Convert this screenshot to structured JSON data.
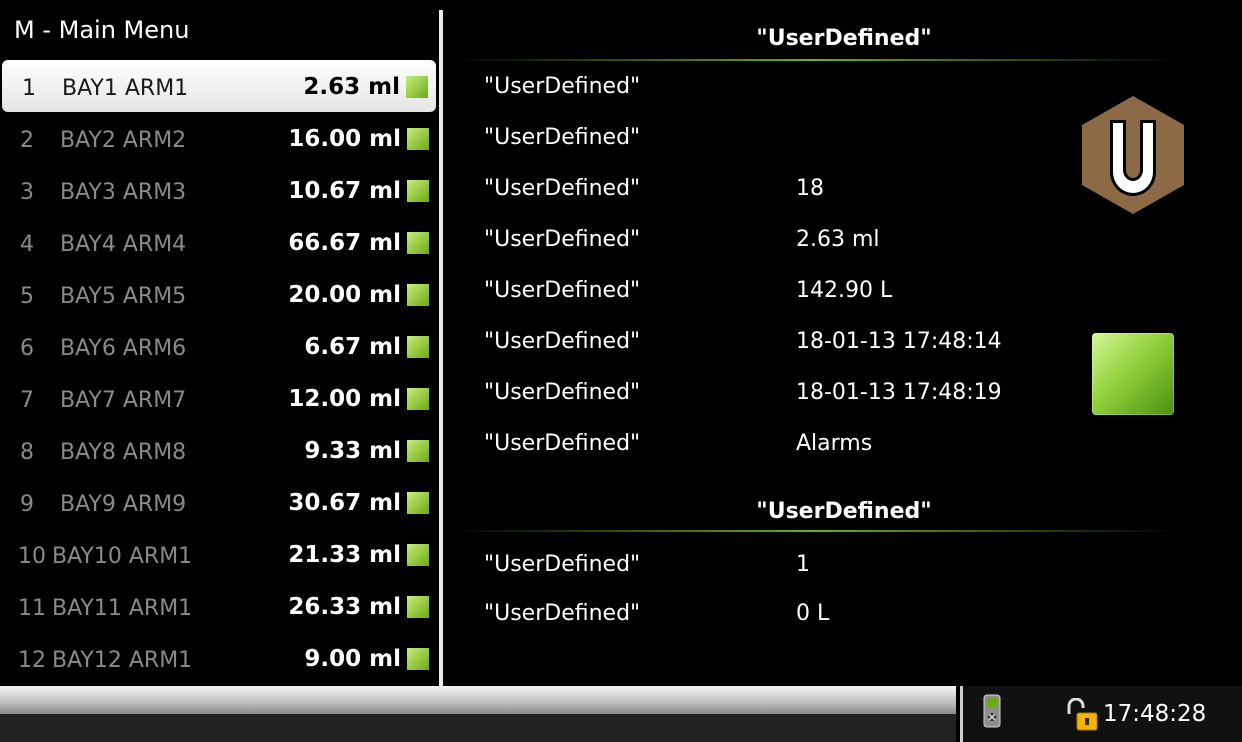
{
  "menu": {
    "title": "M - Main Menu",
    "items": [
      {
        "num": "1",
        "name": "BAY1 ARM1",
        "value": "2.63 ml"
      },
      {
        "num": "2",
        "name": "BAY2 ARM2",
        "value": "16.00 ml"
      },
      {
        "num": "3",
        "name": "BAY3 ARM3",
        "value": "10.67 ml"
      },
      {
        "num": "4",
        "name": "BAY4 ARM4",
        "value": "66.67 ml"
      },
      {
        "num": "5",
        "name": "BAY5 ARM5",
        "value": "20.00 ml"
      },
      {
        "num": "6",
        "name": "BAY6 ARM6",
        "value": "6.67 ml"
      },
      {
        "num": "7",
        "name": "BAY7 ARM7",
        "value": "12.00 ml"
      },
      {
        "num": "8",
        "name": "BAY8 ARM8",
        "value": "9.33 ml"
      },
      {
        "num": "9",
        "name": "BAY9 ARM9",
        "value": "30.67 ml"
      },
      {
        "num": "10",
        "name": "BAY10 ARM1",
        "value": "21.33 ml"
      },
      {
        "num": "11",
        "name": "BAY11 ARM1",
        "value": "26.33 ml"
      },
      {
        "num": "12",
        "name": "BAY12 ARM1",
        "value": "9.00 ml"
      }
    ]
  },
  "details": {
    "title": "\"UserDefined\"",
    "rows": [
      {
        "label": "\"UserDefined\"",
        "value": ""
      },
      {
        "label": "\"UserDefined\"",
        "value": ""
      },
      {
        "label": "\"UserDefined\"",
        "value": "18"
      },
      {
        "label": "\"UserDefined\"",
        "value": "2.63 ml"
      },
      {
        "label": "\"UserDefined\"",
        "value": "142.90 L"
      },
      {
        "label": "\"UserDefined\"",
        "value": "18-01-13 17:48:14"
      },
      {
        "label": "\"UserDefined\"",
        "value": "18-01-13 17:48:19"
      },
      {
        "label": "\"UserDefined\"",
        "value": "Alarms"
      }
    ],
    "logo_letter": "U",
    "logo_color": "#8b6a45",
    "status_color": "#8fd13a"
  },
  "summary": {
    "title": "\"UserDefined\"",
    "rows": [
      {
        "label": "\"UserDefined\"",
        "value": "1"
      },
      {
        "label": "\"UserDefined\"",
        "value": "0 L"
      }
    ]
  },
  "status_bar": {
    "time": "17:48:28",
    "icons": [
      "device-icon",
      "unlocked-lock-icon"
    ]
  },
  "colors": {
    "accent_green": "#6eb11d",
    "selected_row_bg": "#ffffff",
    "muted_text": "#8a8a8a"
  }
}
